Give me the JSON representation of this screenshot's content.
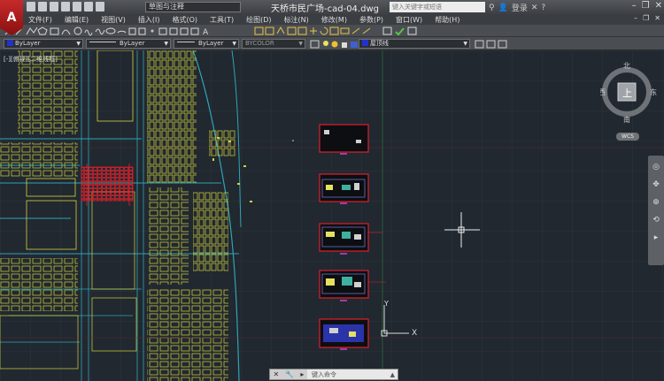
{
  "app": {
    "logo": "A",
    "workspace": "草图与注释",
    "doc_title": "天桥市民广场-cad-04.dwg",
    "search_placeholder": "键入关键字或短语",
    "login": "登录"
  },
  "menu": [
    "文件(F)",
    "编辑(E)",
    "视图(V)",
    "插入(I)",
    "格式(O)",
    "工具(T)",
    "绘图(D)",
    "标注(N)",
    "修改(M)",
    "参数(P)",
    "窗口(W)",
    "帮助(H)"
  ],
  "properties": {
    "color": "ByLayer",
    "linetype": "ByLayer",
    "lineweight": "ByLayer",
    "plotstyle": "BYCOLOR",
    "layer": "屋顶线"
  },
  "viewport_label": "[-][俯视][二维线框]",
  "viewcube": {
    "north": "北",
    "south": "南",
    "east": "东",
    "west": "西",
    "top": "上",
    "wcs": "WCS"
  },
  "ucs": {
    "x": "X",
    "y": "Y"
  },
  "command": {
    "placeholder": "键入命令"
  },
  "colors": {
    "background": "#212830",
    "map_yellow": "#d6d43c",
    "map_cyan": "#2fa5b4",
    "highlight_red": "#e0202a",
    "magenta": "#d040d0"
  }
}
